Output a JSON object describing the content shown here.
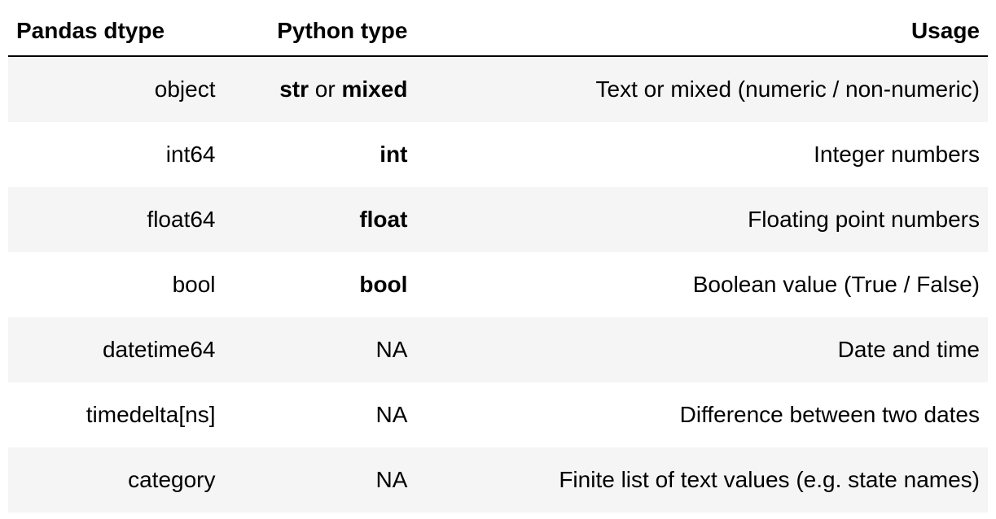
{
  "table": {
    "headers": {
      "col1": "Pandas dtype",
      "col2": "Python type",
      "col3": "Usage"
    },
    "rows": [
      {
        "dtype": "object",
        "ptype_prefix": "str",
        "ptype_mid": " or ",
        "ptype_suffix": "mixed",
        "ptype_plain": "",
        "usage": "Text or mixed (numeric / non-numeric)"
      },
      {
        "dtype": "int64",
        "ptype_prefix": "",
        "ptype_mid": "",
        "ptype_suffix": "",
        "ptype_plain": "int",
        "usage": "Integer numbers"
      },
      {
        "dtype": "float64",
        "ptype_prefix": "",
        "ptype_mid": "",
        "ptype_suffix": "",
        "ptype_plain": "float",
        "usage": "Floating point numbers"
      },
      {
        "dtype": "bool",
        "ptype_prefix": "",
        "ptype_mid": "",
        "ptype_suffix": "",
        "ptype_plain": "bool",
        "usage": "Boolean value (True / False)"
      },
      {
        "dtype": "datetime64",
        "ptype_prefix": "",
        "ptype_mid": "",
        "ptype_suffix": "",
        "ptype_plain": "NA",
        "usage": "Date and time"
      },
      {
        "dtype": "timedelta[ns]",
        "ptype_prefix": "",
        "ptype_mid": "",
        "ptype_suffix": "",
        "ptype_plain": "NA",
        "usage": "Difference between two dates"
      },
      {
        "dtype": "category",
        "ptype_prefix": "",
        "ptype_mid": "",
        "ptype_suffix": "",
        "ptype_plain": "NA",
        "usage": "Finite list of text values (e.g. state names)"
      }
    ]
  },
  "bold_ptypes": [
    "int",
    "float",
    "bool"
  ]
}
